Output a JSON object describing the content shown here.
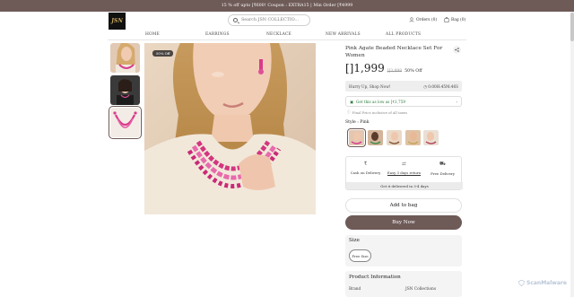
{
  "promo": {
    "text": "15 % off upto [₹600! Coupon : EXTRA15 | Min Order [₹4999"
  },
  "header": {
    "logo": "JSN",
    "search_placeholder": "Search JSN COLLECTIO...",
    "orders": "Orders (0)",
    "bag": "Bag (0)"
  },
  "nav": {
    "items": [
      "HOME",
      "EARRINGS",
      "NECKLACE",
      "NEW ARRIVALS",
      "ALL PRODUCTS"
    ]
  },
  "gallery": {
    "badge": "50% Off"
  },
  "product": {
    "title": "Pink Agate Beaded Necklace Set For Women",
    "price": "[]1,999",
    "mrp": "[]3,998",
    "discount": "50% Off",
    "hurry_label": "Hurry Up, Shop Now!",
    "timer": "0:00H:45M:46S",
    "low_price": "Get this as low as [₹1,759",
    "final_note": "Final Price inclusive of all taxes",
    "style_label": "Style : Pink"
  },
  "features": {
    "cod": "Cash on Delivery",
    "returns": "Easy 3 days return",
    "free": "Free Delivery",
    "delivery": "Get it delivered in 3-4 days"
  },
  "actions": {
    "add": "Add to bag",
    "buy": "Buy Now"
  },
  "size": {
    "label": "Size",
    "option": "Free Size"
  },
  "info": {
    "title": "Product Information",
    "brand_key": "Brand",
    "brand_val": "JSN Collections"
  },
  "watermark": "ScanMalware",
  "colors": {
    "brand": "#6e5a57",
    "green": "#2f7a3b"
  }
}
